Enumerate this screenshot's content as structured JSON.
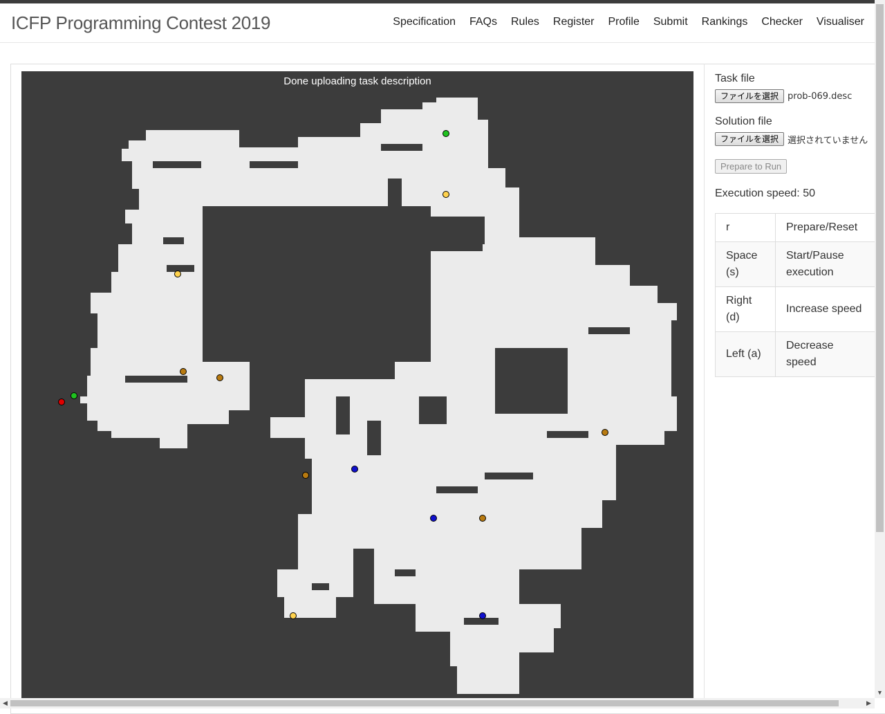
{
  "brand": "ICFP Programming Contest 2019",
  "nav": [
    "Specification",
    "FAQs",
    "Rules",
    "Register",
    "Profile",
    "Submit",
    "Rankings",
    "Checker",
    "Visualiser"
  ],
  "canvas": {
    "status": "Done uploading task description",
    "colors": {
      "background": "#3c3c3c",
      "floor": "#ebebeb",
      "obstacle": "#3c3c3c",
      "robot": "#e00000",
      "clone": "#1fc21f",
      "booster_yellow": "#ffd24d",
      "booster_brown": "#b87a10",
      "booster_blue": "#1010cc"
    },
    "markers": [
      {
        "kind": "robot",
        "color": "#e00000"
      },
      {
        "kind": "clone",
        "color": "#1fc21f"
      },
      {
        "kind": "clone",
        "color": "#1fc21f"
      },
      {
        "kind": "booster",
        "color": "#ffd24d"
      },
      {
        "kind": "booster",
        "color": "#ffd24d"
      },
      {
        "kind": "booster",
        "color": "#ffd24d"
      },
      {
        "kind": "booster",
        "color": "#b87a10"
      },
      {
        "kind": "booster",
        "color": "#b87a10"
      },
      {
        "kind": "booster",
        "color": "#b87a10"
      },
      {
        "kind": "booster",
        "color": "#b87a10"
      },
      {
        "kind": "booster",
        "color": "#b87a10"
      },
      {
        "kind": "booster",
        "color": "#1010cc"
      },
      {
        "kind": "booster",
        "color": "#1010cc"
      },
      {
        "kind": "booster",
        "color": "#1010cc"
      }
    ]
  },
  "side": {
    "task_label": "Task file",
    "task_button": "ファイルを選択",
    "task_file": "prob-069.desc",
    "solution_label": "Solution file",
    "solution_button": "ファイルを選択",
    "solution_file": "選択されていません",
    "prepare_button": "Prepare to Run",
    "speed_text": "Execution speed: 50",
    "keys": [
      {
        "key": "r",
        "action": "Prepare/Reset"
      },
      {
        "key": "Space (s)",
        "action": "Start/Pause execution"
      },
      {
        "key": "Right (d)",
        "action": "Increase speed"
      },
      {
        "key": "Left (a)",
        "action": "Decrease speed"
      }
    ]
  }
}
